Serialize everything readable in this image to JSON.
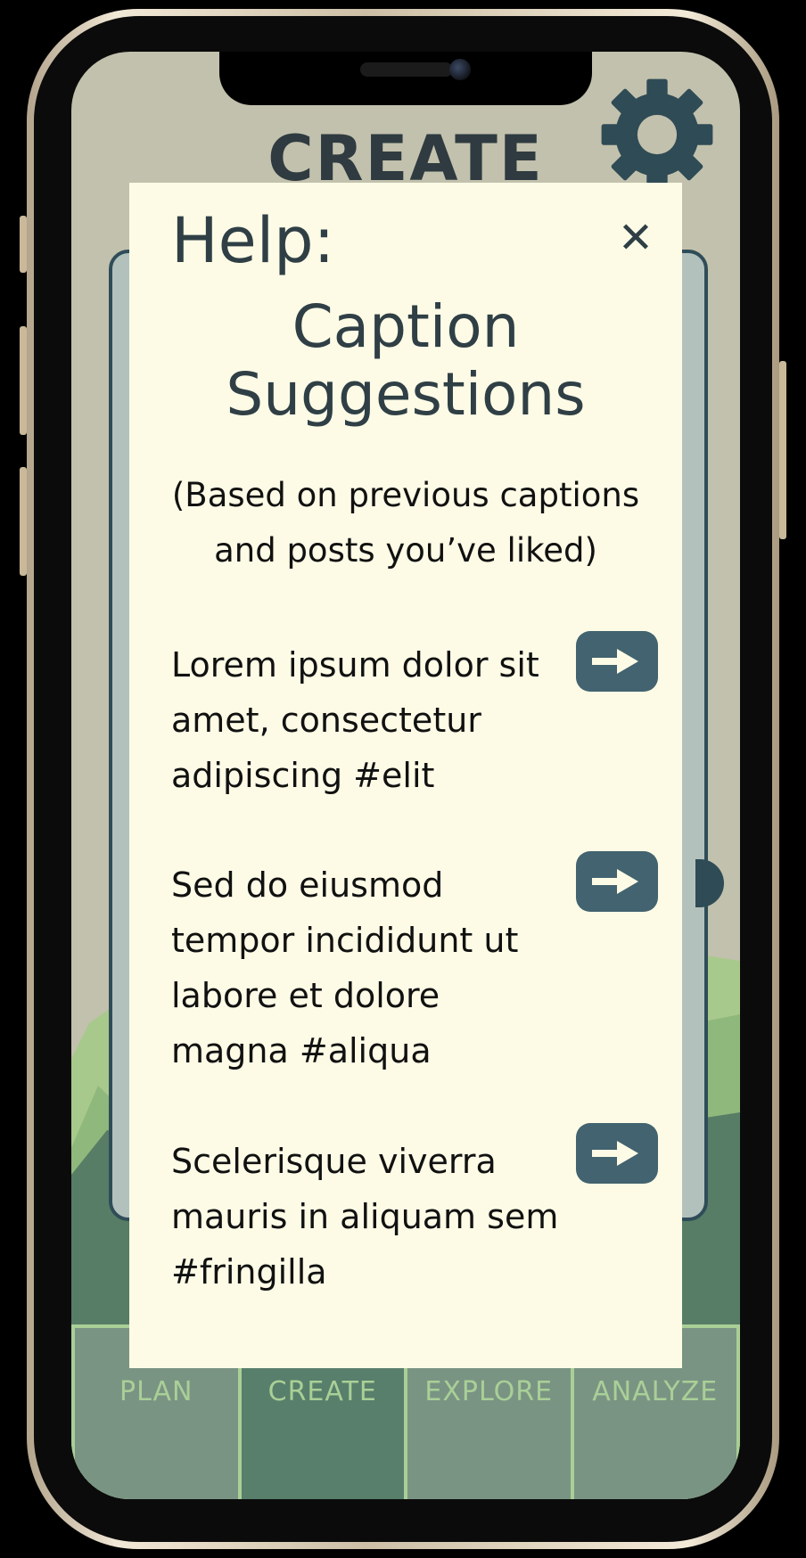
{
  "app": {
    "screen_title": "CREATE",
    "settings_icon": "gear-icon"
  },
  "help_modal": {
    "label": "Help:",
    "close_icon": "close-icon",
    "close_glyph": "✕",
    "title_line1": "Caption",
    "title_line2": "Suggestions",
    "subtitle": "(Based on previous captions and posts you’ve liked)",
    "suggestions": [
      {
        "text": "Lorem ipsum dolor sit amet, consectetur adipiscing #elit",
        "action_icon": "arrow-right-icon"
      },
      {
        "text": "Sed do eiusmod tempor incididunt ut labore et dolore magna #aliqua",
        "action_icon": "arrow-right-icon"
      },
      {
        "text": "Scelerisque viverra mauris in aliquam sem #fringilla",
        "action_icon": "arrow-right-icon"
      }
    ]
  },
  "tab_bar": {
    "active": "CREATE",
    "tabs": [
      {
        "label": "PLAN"
      },
      {
        "label": "CREATE"
      },
      {
        "label": "EXPLORE"
      },
      {
        "label": "ANALYZE"
      }
    ]
  },
  "colors": {
    "background": "#c2c1ad",
    "modal": "#fdfbe6",
    "accent": "#42636f",
    "text_dark": "#2f3f45",
    "tab_bar": "#a9cf97",
    "tab_active": "#587f6b"
  }
}
